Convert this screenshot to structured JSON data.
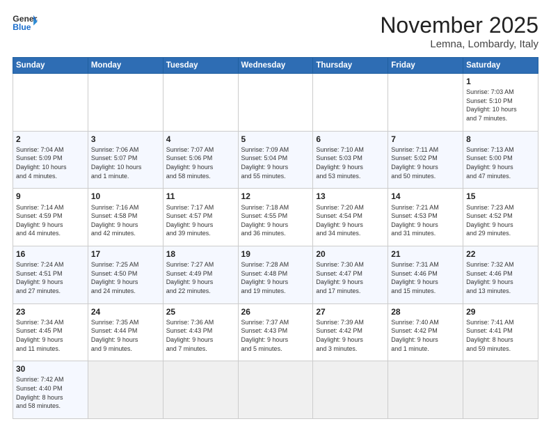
{
  "header": {
    "logo_general": "General",
    "logo_blue": "Blue",
    "month_title": "November 2025",
    "location": "Lemna, Lombardy, Italy"
  },
  "weekdays": [
    "Sunday",
    "Monday",
    "Tuesday",
    "Wednesday",
    "Thursday",
    "Friday",
    "Saturday"
  ],
  "weeks": [
    [
      {
        "day": "",
        "info": ""
      },
      {
        "day": "",
        "info": ""
      },
      {
        "day": "",
        "info": ""
      },
      {
        "day": "",
        "info": ""
      },
      {
        "day": "",
        "info": ""
      },
      {
        "day": "",
        "info": ""
      },
      {
        "day": "1",
        "info": "Sunrise: 7:03 AM\nSunset: 5:10 PM\nDaylight: 10 hours\nand 7 minutes."
      }
    ],
    [
      {
        "day": "2",
        "info": "Sunrise: 7:04 AM\nSunset: 5:09 PM\nDaylight: 10 hours\nand 4 minutes."
      },
      {
        "day": "3",
        "info": "Sunrise: 7:06 AM\nSunset: 5:07 PM\nDaylight: 10 hours\nand 1 minute."
      },
      {
        "day": "4",
        "info": "Sunrise: 7:07 AM\nSunset: 5:06 PM\nDaylight: 9 hours\nand 58 minutes."
      },
      {
        "day": "5",
        "info": "Sunrise: 7:09 AM\nSunset: 5:04 PM\nDaylight: 9 hours\nand 55 minutes."
      },
      {
        "day": "6",
        "info": "Sunrise: 7:10 AM\nSunset: 5:03 PM\nDaylight: 9 hours\nand 53 minutes."
      },
      {
        "day": "7",
        "info": "Sunrise: 7:11 AM\nSunset: 5:02 PM\nDaylight: 9 hours\nand 50 minutes."
      },
      {
        "day": "8",
        "info": "Sunrise: 7:13 AM\nSunset: 5:00 PM\nDaylight: 9 hours\nand 47 minutes."
      }
    ],
    [
      {
        "day": "9",
        "info": "Sunrise: 7:14 AM\nSunset: 4:59 PM\nDaylight: 9 hours\nand 44 minutes."
      },
      {
        "day": "10",
        "info": "Sunrise: 7:16 AM\nSunset: 4:58 PM\nDaylight: 9 hours\nand 42 minutes."
      },
      {
        "day": "11",
        "info": "Sunrise: 7:17 AM\nSunset: 4:57 PM\nDaylight: 9 hours\nand 39 minutes."
      },
      {
        "day": "12",
        "info": "Sunrise: 7:18 AM\nSunset: 4:55 PM\nDaylight: 9 hours\nand 36 minutes."
      },
      {
        "day": "13",
        "info": "Sunrise: 7:20 AM\nSunset: 4:54 PM\nDaylight: 9 hours\nand 34 minutes."
      },
      {
        "day": "14",
        "info": "Sunrise: 7:21 AM\nSunset: 4:53 PM\nDaylight: 9 hours\nand 31 minutes."
      },
      {
        "day": "15",
        "info": "Sunrise: 7:23 AM\nSunset: 4:52 PM\nDaylight: 9 hours\nand 29 minutes."
      }
    ],
    [
      {
        "day": "16",
        "info": "Sunrise: 7:24 AM\nSunset: 4:51 PM\nDaylight: 9 hours\nand 27 minutes."
      },
      {
        "day": "17",
        "info": "Sunrise: 7:25 AM\nSunset: 4:50 PM\nDaylight: 9 hours\nand 24 minutes."
      },
      {
        "day": "18",
        "info": "Sunrise: 7:27 AM\nSunset: 4:49 PM\nDaylight: 9 hours\nand 22 minutes."
      },
      {
        "day": "19",
        "info": "Sunrise: 7:28 AM\nSunset: 4:48 PM\nDaylight: 9 hours\nand 19 minutes."
      },
      {
        "day": "20",
        "info": "Sunrise: 7:30 AM\nSunset: 4:47 PM\nDaylight: 9 hours\nand 17 minutes."
      },
      {
        "day": "21",
        "info": "Sunrise: 7:31 AM\nSunset: 4:46 PM\nDaylight: 9 hours\nand 15 minutes."
      },
      {
        "day": "22",
        "info": "Sunrise: 7:32 AM\nSunset: 4:46 PM\nDaylight: 9 hours\nand 13 minutes."
      }
    ],
    [
      {
        "day": "23",
        "info": "Sunrise: 7:34 AM\nSunset: 4:45 PM\nDaylight: 9 hours\nand 11 minutes."
      },
      {
        "day": "24",
        "info": "Sunrise: 7:35 AM\nSunset: 4:44 PM\nDaylight: 9 hours\nand 9 minutes."
      },
      {
        "day": "25",
        "info": "Sunrise: 7:36 AM\nSunset: 4:43 PM\nDaylight: 9 hours\nand 7 minutes."
      },
      {
        "day": "26",
        "info": "Sunrise: 7:37 AM\nSunset: 4:43 PM\nDaylight: 9 hours\nand 5 minutes."
      },
      {
        "day": "27",
        "info": "Sunrise: 7:39 AM\nSunset: 4:42 PM\nDaylight: 9 hours\nand 3 minutes."
      },
      {
        "day": "28",
        "info": "Sunrise: 7:40 AM\nSunset: 4:42 PM\nDaylight: 9 hours\nand 1 minute."
      },
      {
        "day": "29",
        "info": "Sunrise: 7:41 AM\nSunset: 4:41 PM\nDaylight: 8 hours\nand 59 minutes."
      }
    ],
    [
      {
        "day": "30",
        "info": "Sunrise: 7:42 AM\nSunset: 4:40 PM\nDaylight: 8 hours\nand 58 minutes."
      },
      {
        "day": "",
        "info": ""
      },
      {
        "day": "",
        "info": ""
      },
      {
        "day": "",
        "info": ""
      },
      {
        "day": "",
        "info": ""
      },
      {
        "day": "",
        "info": ""
      },
      {
        "day": "",
        "info": ""
      }
    ]
  ]
}
